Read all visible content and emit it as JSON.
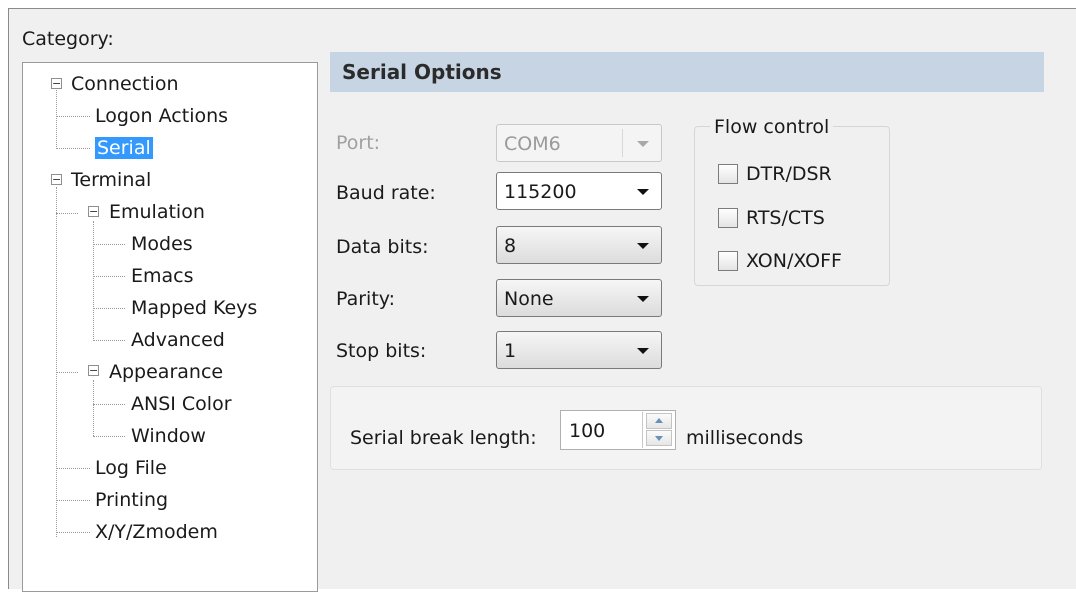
{
  "category_label": "Category:",
  "tree": {
    "connection": "Connection",
    "logon_actions": "Logon Actions",
    "serial": "Serial",
    "terminal": "Terminal",
    "emulation": "Emulation",
    "modes": "Modes",
    "emacs": "Emacs",
    "mapped_keys": "Mapped Keys",
    "advanced": "Advanced",
    "appearance": "Appearance",
    "ansi_color": "ANSI Color",
    "window": "Window",
    "log_file": "Log File",
    "printing": "Printing",
    "xyzmodem": "X/Y/Zmodem",
    "expander_symbol": "−"
  },
  "panel": {
    "title": "Serial Options",
    "port_label": "Port:",
    "port_value": "COM6",
    "baud_label": "Baud rate:",
    "baud_value": "115200",
    "databits_label": "Data bits:",
    "databits_value": "8",
    "parity_label": "Parity:",
    "parity_value": "None",
    "stopbits_label": "Stop bits:",
    "stopbits_value": "1"
  },
  "flow_control": {
    "title": "Flow control",
    "dtr_dsr": "DTR/DSR",
    "rts_cts": "RTS/CTS",
    "xon_xoff": "XON/XOFF",
    "dtr_dsr_checked": false,
    "rts_cts_checked": false,
    "xon_xoff_checked": false
  },
  "break": {
    "label": "Serial break length:",
    "value": "100",
    "unit": "milliseconds"
  },
  "colors": {
    "header_bg": "#c6d4e4",
    "selection": "#3399ff"
  }
}
